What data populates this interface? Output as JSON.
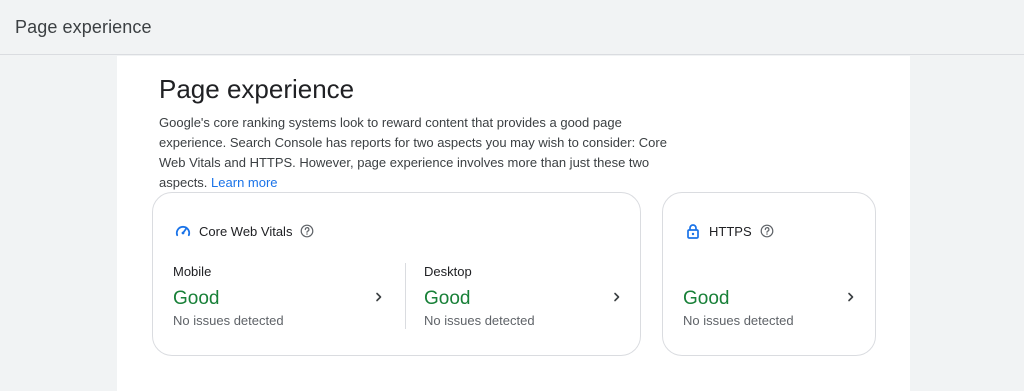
{
  "header": {
    "title": "Page experience"
  },
  "main": {
    "title": "Page experience",
    "intro_text": "Google's core ranking systems look to reward content that provides a good page experience. Search Console has reports for two aspects you may wish to consider: Core Web Vitals and HTTPS. However, page experience involves more than just these two aspects.",
    "learn_more": "Learn more"
  },
  "cards": {
    "core_web_vitals": {
      "title": "Core Web Vitals",
      "icon": "speedometer-icon",
      "mobile": {
        "device": "Mobile",
        "status": "Good",
        "detail": "No issues detected"
      },
      "desktop": {
        "device": "Desktop",
        "status": "Good",
        "detail": "No issues detected"
      }
    },
    "https": {
      "title": "HTTPS",
      "icon": "lock-icon",
      "status": "Good",
      "detail": "No issues detected"
    }
  },
  "colors": {
    "good": "#188038",
    "link": "#1a73e8",
    "icon_blue": "#1a73e8"
  }
}
